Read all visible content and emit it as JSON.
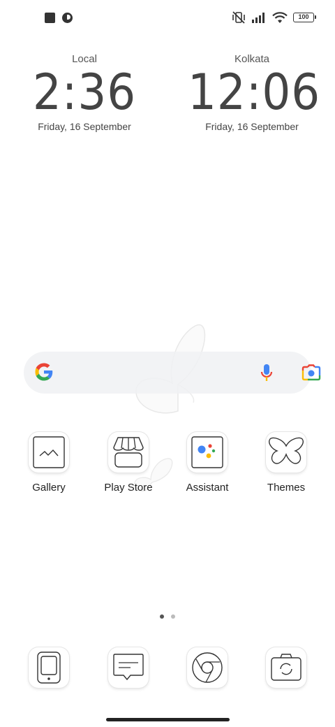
{
  "status_bar": {
    "left_icons": [
      "stop-square-icon",
      "notification-app-icon"
    ],
    "right_icons": [
      "vibrate-off-icon",
      "signal-icon",
      "wifi-icon"
    ],
    "battery": "100"
  },
  "clocks": [
    {
      "city": "Local",
      "time": "2:36",
      "date": "Friday, 16 September"
    },
    {
      "city": "Kolkata",
      "time": "12:06",
      "date": "Friday, 16 September"
    }
  ],
  "search": {
    "icons": [
      "google-logo-icon",
      "microphone-icon",
      "google-lens-icon"
    ]
  },
  "apps": [
    {
      "label": "Gallery",
      "icon": "gallery-icon"
    },
    {
      "label": "Play Store",
      "icon": "store-icon"
    },
    {
      "label": "Assistant",
      "icon": "assistant-icon"
    },
    {
      "label": "Themes",
      "icon": "butterfly-icon"
    }
  ],
  "pager": {
    "pages": 2,
    "current": 1
  },
  "dock": [
    {
      "icon": "phone-icon"
    },
    {
      "icon": "messages-icon"
    },
    {
      "icon": "chrome-icon"
    },
    {
      "icon": "camera-icon"
    }
  ],
  "colors": {
    "background": "#ffffff",
    "text": "#444444",
    "google_blue": "#4285F4",
    "google_red": "#EA4335",
    "google_yellow": "#FBBC05",
    "google_green": "#34A853"
  }
}
